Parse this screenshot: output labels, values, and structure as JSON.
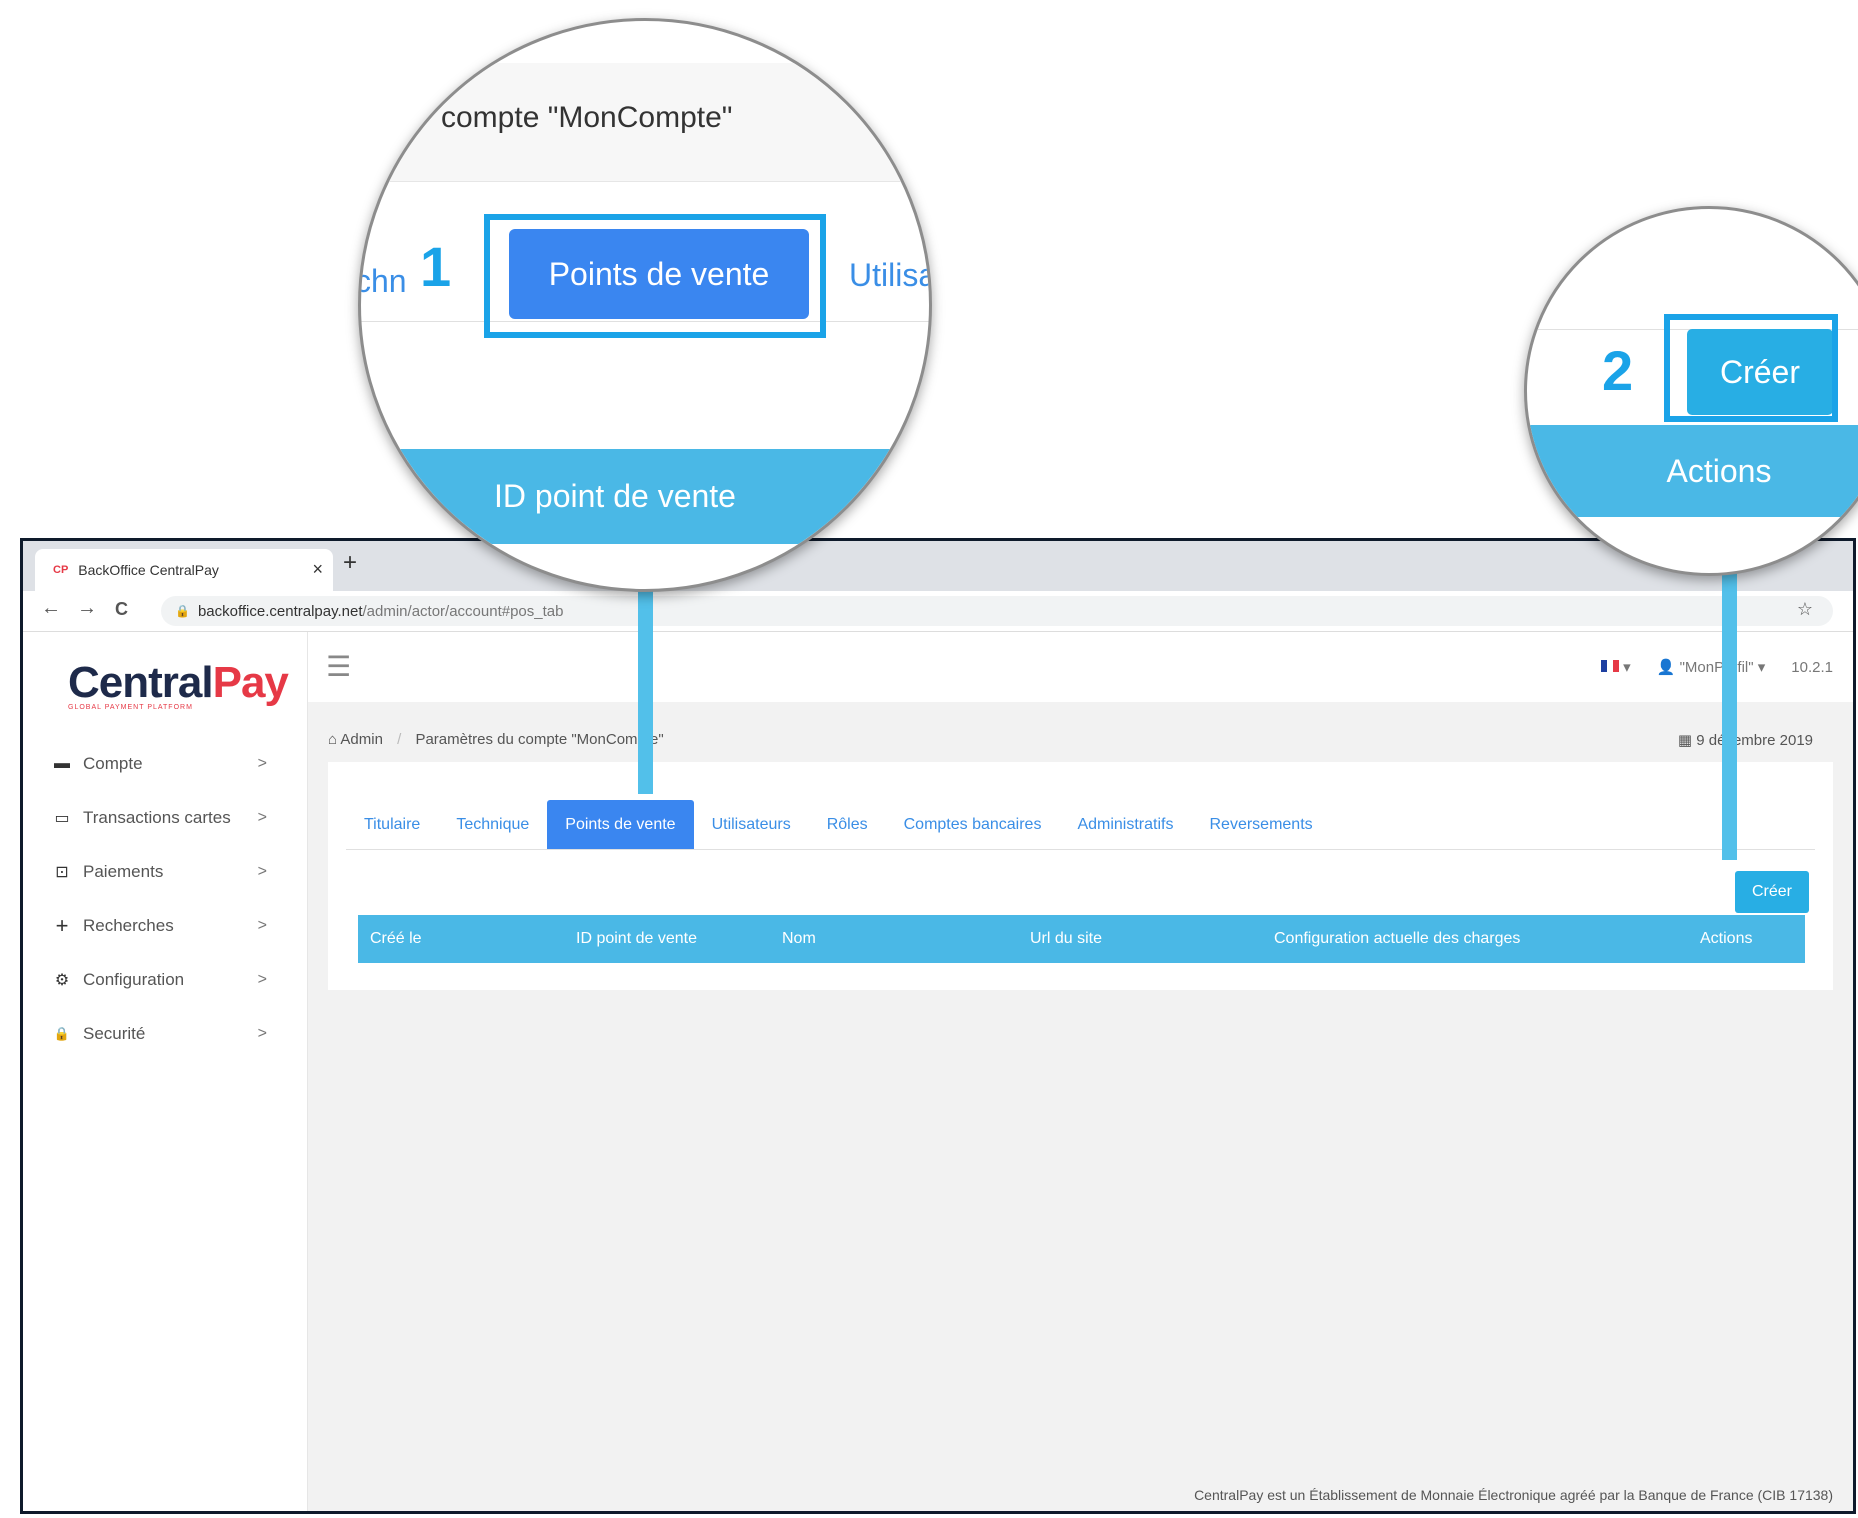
{
  "browser": {
    "tab_title": "BackOffice CentralPay",
    "favicon_text": "CP",
    "close_symbol": "×",
    "new_tab_symbol": "+",
    "back_symbol": "←",
    "forward_symbol": "→",
    "reload_symbol": "C",
    "url_domain": "backoffice.centralpay.net",
    "url_path": "/admin/actor/account#pos_tab",
    "lock_symbol": "🔒",
    "star_symbol": "☆"
  },
  "logo": {
    "part1": "Central",
    "part2": "Pay",
    "tagline": "GLOBAL PAYMENT PLATFORM"
  },
  "sidebar": {
    "items": [
      {
        "label": "Compte",
        "icon": "wallet-icon"
      },
      {
        "label": "Transactions cartes",
        "icon": "credit-card-icon"
      },
      {
        "label": "Paiements",
        "icon": "money-icon"
      },
      {
        "label": "Recherches",
        "icon": "plus-icon"
      },
      {
        "label": "Configuration",
        "icon": "gears-icon"
      },
      {
        "label": "Securité",
        "icon": "lock-icon"
      }
    ],
    "chevron": ">"
  },
  "topbar": {
    "menu_symbol": "☰",
    "flag_caret": "▾",
    "profile": "\"MonProfil\"",
    "profile_caret": "▾",
    "version": "10.2.1"
  },
  "breadcrumb": {
    "home": "Admin",
    "separator": "/",
    "current": "Paramètres du compte \"MonCompte\""
  },
  "date": "9 décembre 2019",
  "tabs": [
    "Titulaire",
    "Technique",
    "Points de vente",
    "Utilisateurs",
    "Rôles",
    "Comptes bancaires",
    "Administratifs",
    "Reversements"
  ],
  "active_tab": "Points de vente",
  "create_button": "Créer",
  "table_headers": [
    "Créé le",
    "ID point de vente",
    "Nom",
    "Url du site",
    "Configuration actuelle des charges",
    "Actions"
  ],
  "footer": "CentralPay est un Établissement de Monnaie Électronique agréé par la Banque de France (CIB 17138)",
  "callouts": {
    "zoom1": {
      "title": "compte \"MonCompte\"",
      "prev_tab_fragment": "chn",
      "active_tab": "Points de vente",
      "next_tab_fragment": "Utilisa",
      "header": "ID point de vente",
      "number": "1"
    },
    "zoom2": {
      "button": "Créer",
      "header": "Actions",
      "number": "2"
    }
  },
  "colors": {
    "accent": "#3a86f0",
    "table_header": "#4ab8e6",
    "callout": "#1aa3e8",
    "brand_red": "#e63946",
    "brand_navy": "#1e2a4a"
  }
}
